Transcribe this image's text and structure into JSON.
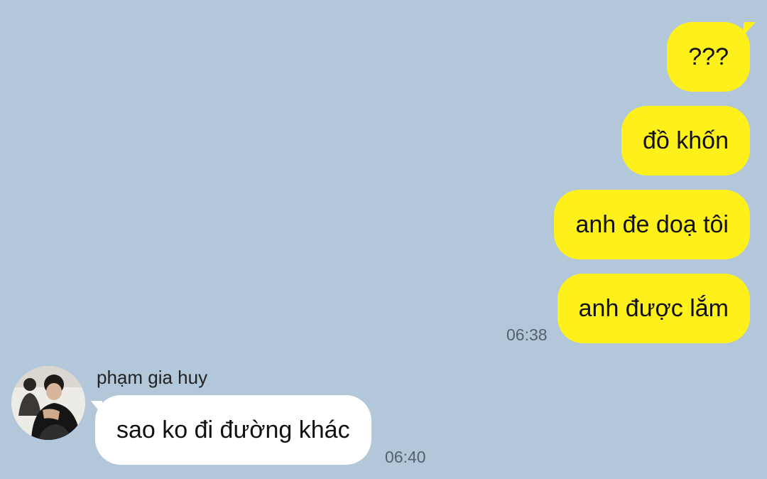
{
  "conversation": {
    "outgoing": [
      {
        "text": "???"
      },
      {
        "text": "đồ khốn"
      },
      {
        "text": "anh đe doạ tôi"
      },
      {
        "text": "anh được lắm"
      }
    ],
    "outgoing_time": "06:38",
    "incoming": {
      "sender_name": "phạm gia huy",
      "avatar_icon": "avatar-photo",
      "messages": [
        {
          "text": "sao ko đi đường khác"
        }
      ],
      "time": "06:40"
    }
  },
  "colors": {
    "background": "#b2c7da",
    "outgoing_bubble": "#fef01b",
    "incoming_bubble": "#ffffff",
    "timestamp": "#56606b"
  }
}
